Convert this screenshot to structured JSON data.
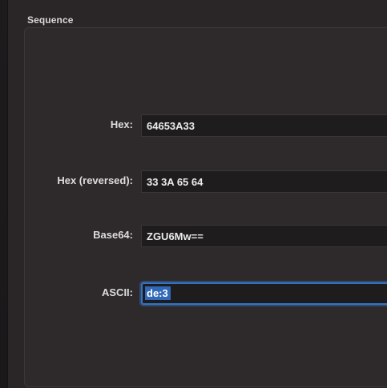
{
  "section": {
    "title": "Sequence"
  },
  "fields": [
    {
      "label": "Hex:",
      "value": "64653A33"
    },
    {
      "label": "Hex (reversed):",
      "value": "33 3A 65 64"
    },
    {
      "label": "Base64:",
      "value": "ZGU6Mw=="
    },
    {
      "label": "ASCII:",
      "value": "de:3"
    }
  ],
  "colors": {
    "background": "#2a2627",
    "group_box": "#2e2a2b",
    "field_background": "#1f1c1d",
    "focus_accent": "#2f74c5",
    "selection": "#3168b8"
  }
}
